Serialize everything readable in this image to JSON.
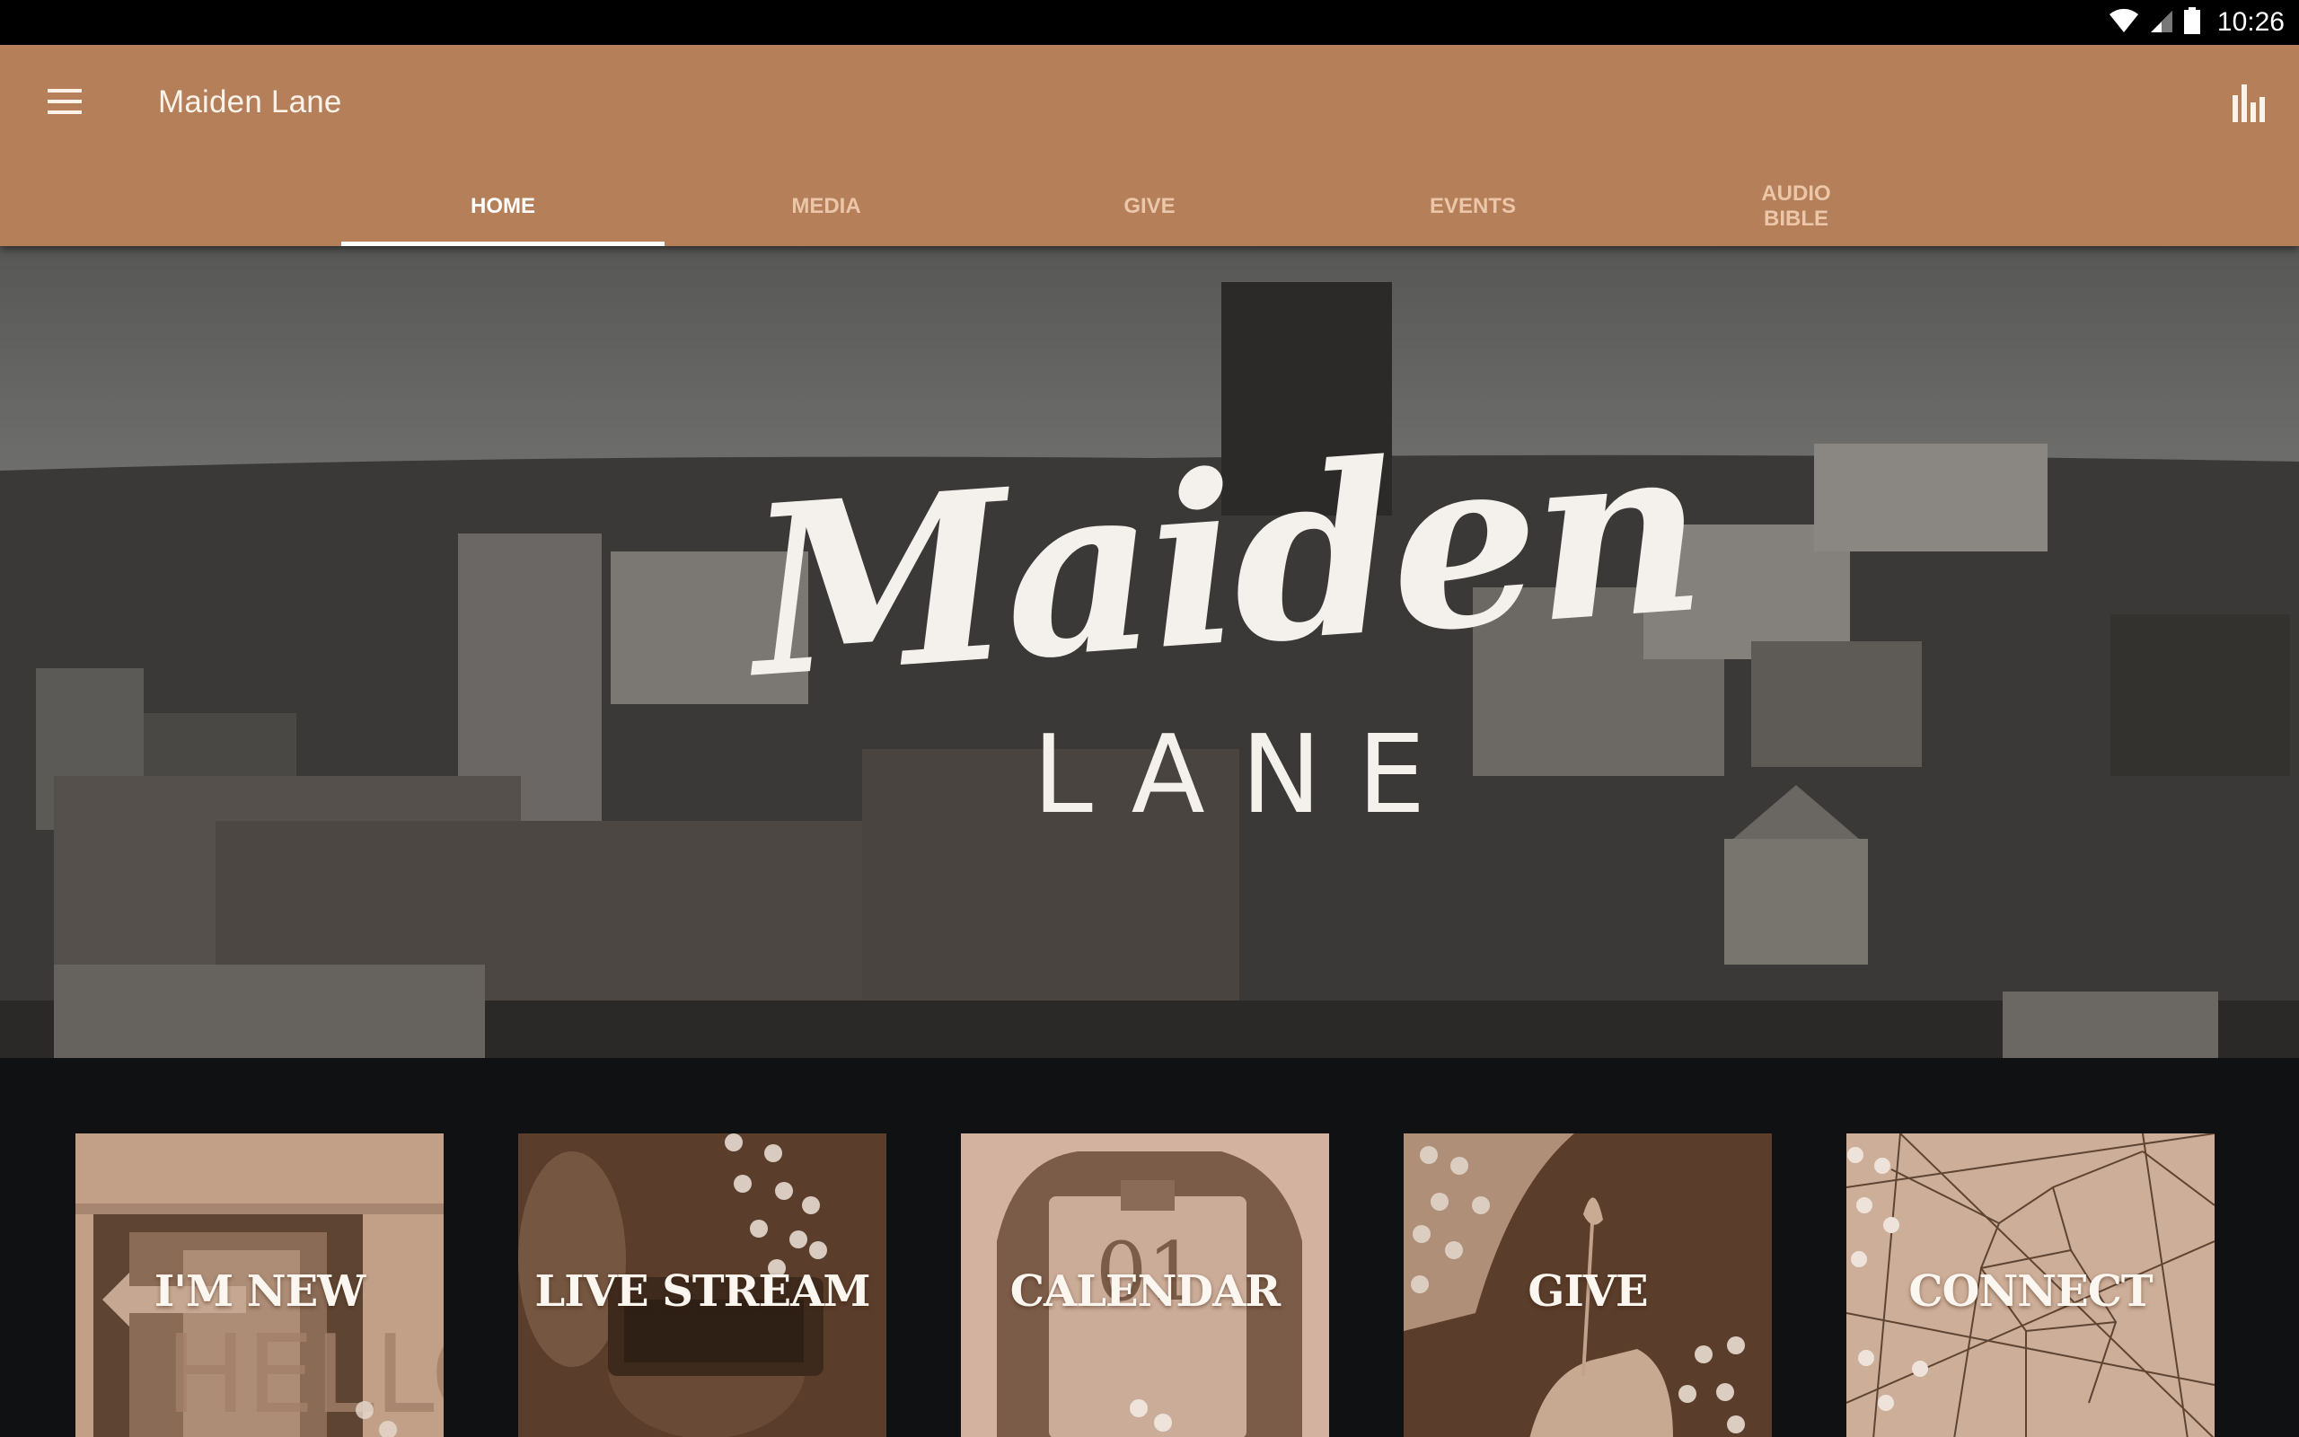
{
  "status_bar": {
    "time": "10:26",
    "icons": [
      "wifi-icon",
      "cellular-signal-icon",
      "battery-icon"
    ]
  },
  "app_bar": {
    "title": "Maiden Lane",
    "menu_icon": "hamburger-menu-icon",
    "action_icon": "bar-chart-icon",
    "color": "#b47f59"
  },
  "tabs": [
    {
      "label": "HOME",
      "active": true
    },
    {
      "label": "MEDIA",
      "active": false
    },
    {
      "label": "GIVE",
      "active": false
    },
    {
      "label": "EVENTS",
      "active": false
    },
    {
      "label": "AUDIO BIBLE",
      "active": false
    }
  ],
  "hero": {
    "logo_script": "Maiden",
    "logo_sub": "LANE"
  },
  "tiles": [
    {
      "label": "I'M NEW"
    },
    {
      "label": "LIVE STREAM"
    },
    {
      "label": "CALENDAR"
    },
    {
      "label": "GIVE"
    },
    {
      "label": "CONNECT"
    }
  ]
}
